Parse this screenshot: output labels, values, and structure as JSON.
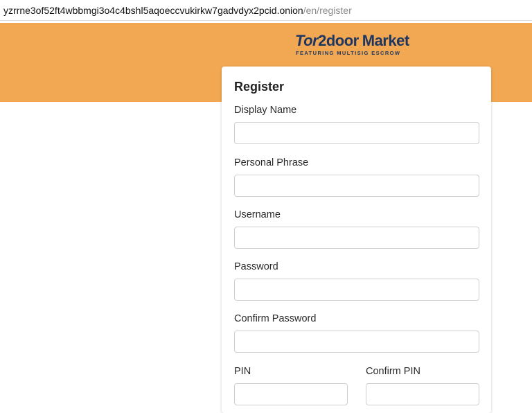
{
  "browser": {
    "url_host": "yzrrne3of52ft4wbbmgi3o4c4bshl5aqoeccvukirkw7gadvdyx2pcid.onion",
    "url_path": "/en/register"
  },
  "header": {
    "logo_brand": "Tor",
    "logo_brand_2": "2door",
    "logo_market": "Market",
    "logo_tagline": "FEATURING MULTISIG ESCROW"
  },
  "form": {
    "title": "Register",
    "fields": [
      {
        "label": "Display Name",
        "value": ""
      },
      {
        "label": "Personal Phrase",
        "value": ""
      },
      {
        "label": "Username",
        "value": ""
      },
      {
        "label": "Password",
        "value": ""
      },
      {
        "label": "Confirm Password",
        "value": ""
      },
      {
        "label": "PIN",
        "value": ""
      },
      {
        "label": "Confirm PIN",
        "value": ""
      }
    ]
  }
}
